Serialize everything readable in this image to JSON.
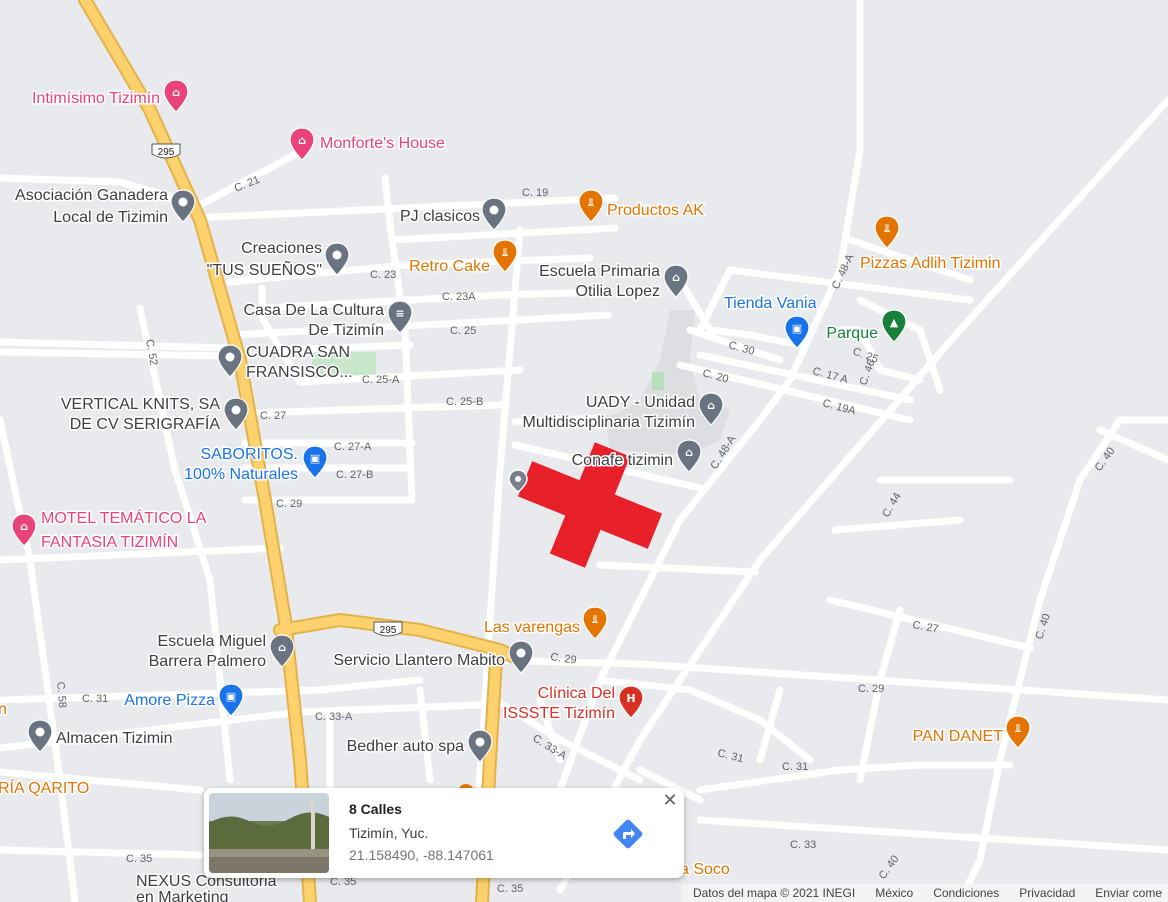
{
  "colors": {
    "background": "#e8eaed",
    "road": "#ffffff",
    "highway": "#fdd26e",
    "highway_edge": "#e3b34a",
    "park": "#c8e6c9",
    "campus": "#d8dadd",
    "marker_red": "#e8202a",
    "poi_gray": "#6a7480",
    "poi_orange": "#e37400",
    "poi_pink": "#e8437a",
    "poi_blue": "#1a73e8",
    "poi_green": "#188038",
    "poi_red": "#d93025",
    "road_label": "#5f6368"
  },
  "map": {
    "highway_shields": [
      "295",
      "295"
    ],
    "street_labels": [
      "C. 19",
      "C. 21",
      "C. 23",
      "C. 23A",
      "C. 25",
      "C. 25-A",
      "C. 25-B",
      "C. 27",
      "C. 27-A",
      "C. 27-B",
      "C. 29",
      "C. 29",
      "C. 29",
      "C. 31",
      "C. 31",
      "C. 31",
      "C. 33-A",
      "C. 33-A",
      "C. 33",
      "C. 35",
      "C. 35",
      "C. 35",
      "C. 52",
      "C. 58",
      "C. 30",
      "C. 20",
      "C. 17 A",
      "C. 19A",
      "C. 25",
      "C. 46",
      "C. 48-A",
      "C. 48-A",
      "C. 44",
      "C. 40",
      "C. 40",
      "C. 40",
      "C. 27"
    ],
    "places": [
      {
        "name": "Intimísimo Tizimín",
        "icon": "hotel-icon",
        "color": "pink"
      },
      {
        "name": "Monforte's House",
        "icon": "hotel-icon",
        "color": "pink"
      },
      {
        "name": "Asociación Ganadera Local de Tizimin",
        "lines": [
          "Asociación Ganadera",
          "Local de Tizimin"
        ],
        "icon": "location-pin-icon",
        "color": "gray"
      },
      {
        "name": "PJ clasicos",
        "icon": "location-pin-icon",
        "color": "gray"
      },
      {
        "name": "Productos AK",
        "icon": "restaurant-icon",
        "color": "orange"
      },
      {
        "name": "Creaciones \"TUS SUEÑOS\"",
        "lines": [
          "Creaciones",
          "\"TUS SUEÑOS\""
        ],
        "icon": "location-pin-icon",
        "color": "gray"
      },
      {
        "name": "Retro Cake",
        "icon": "restaurant-icon",
        "color": "orange"
      },
      {
        "name": "Escuela Primaria Otilia Lopez",
        "lines": [
          "Escuela Primaria",
          "Otilia Lopez"
        ],
        "icon": "school-icon",
        "color": "gray"
      },
      {
        "name": "Pizzas Adlih Tizimin",
        "icon": "restaurant-icon",
        "color": "orange"
      },
      {
        "name": "Casa De La Cultura De Tizimín",
        "lines": [
          "Casa De La Cultura",
          "De Tizimín"
        ],
        "icon": "museum-icon",
        "color": "gray"
      },
      {
        "name": "Tienda Vania",
        "icon": "shopping-cart-icon",
        "color": "blue"
      },
      {
        "name": "Parque",
        "icon": "park-tree-icon",
        "color": "green"
      },
      {
        "name": "CUADRA SAN FRANSISCO...",
        "lines": [
          "CUADRA SAN",
          "FRANSISCO..."
        ],
        "icon": "location-pin-icon",
        "color": "gray"
      },
      {
        "name": "VERTICAL KNITS, SA DE CV SERIGRAFÍA",
        "lines": [
          "VERTICAL KNITS, SA",
          "DE CV SERIGRAFÍA"
        ],
        "icon": "location-pin-icon",
        "color": "gray"
      },
      {
        "name": "UADY - Unidad Multidisciplinaria Tizimín",
        "lines": [
          "UADY - Unidad",
          "Multidisciplinaria Tizimín"
        ],
        "icon": "school-icon",
        "color": "gray"
      },
      {
        "name": "SABORITOS. 100% Naturales",
        "lines": [
          "SABORITOS.",
          "100% Naturales"
        ],
        "icon": "shopping-cart-icon",
        "color": "blue"
      },
      {
        "name": "Conafe tizimin",
        "icon": "school-icon",
        "color": "gray"
      },
      {
        "name": "MOTEL TEMÁTICO LA FANTASIA TIZIMÍN",
        "lines": [
          "MOTEL TEMÁTICO LA",
          "FANTASIA TIZIMÍN"
        ],
        "icon": "hotel-icon",
        "color": "pink"
      },
      {
        "name": "Las varengas",
        "icon": "restaurant-icon",
        "color": "orange"
      },
      {
        "name": "Escuela Miguel Barrera Palmero",
        "lines": [
          "Escuela Miguel",
          "Barrera Palmero"
        ],
        "icon": "school-icon",
        "color": "gray"
      },
      {
        "name": "Servicio Llantero Mabito",
        "icon": "location-pin-icon",
        "color": "gray"
      },
      {
        "name": "Amore Pizza",
        "icon": "shopping-cart-icon",
        "color": "blue"
      },
      {
        "name": "Clínica Del ISSSTE Tizimín",
        "lines": [
          "Clínica Del",
          "ISSSTE Tizimín"
        ],
        "icon": "hospital-icon",
        "color": "red"
      },
      {
        "name": "Almacen Tizimin",
        "icon": "location-pin-icon",
        "color": "gray"
      },
      {
        "name": "Bedher auto spa",
        "icon": "location-pin-icon",
        "color": "gray"
      },
      {
        "name": "PAN DANET",
        "icon": "restaurant-icon",
        "color": "orange"
      },
      {
        "name": "RÍA QARITO",
        "icon": "none",
        "color": "orange"
      },
      {
        "name": "a Soco",
        "icon": "none",
        "color": "orange"
      },
      {
        "name": "NEXUS Consultoria en Marketing",
        "lines": [
          "NEXUS Consultoria",
          "en Marketing"
        ],
        "icon": "none",
        "color": "gray"
      },
      {
        "name": "n",
        "icon": "none",
        "color": "orange"
      }
    ],
    "selected_marker": "red-cross-marker"
  },
  "info_card": {
    "title": "8 Calles",
    "subtitle": "Tizimín, Yuc.",
    "coordinates": "21.158490, -88.147061",
    "close_icon": "close-icon",
    "directions_icon": "directions-icon"
  },
  "attribution": {
    "data": "Datos del mapa © 2021 INEGI",
    "country": "México",
    "terms": "Condiciones",
    "privacy": "Privacidad",
    "feedback": "Enviar come"
  }
}
